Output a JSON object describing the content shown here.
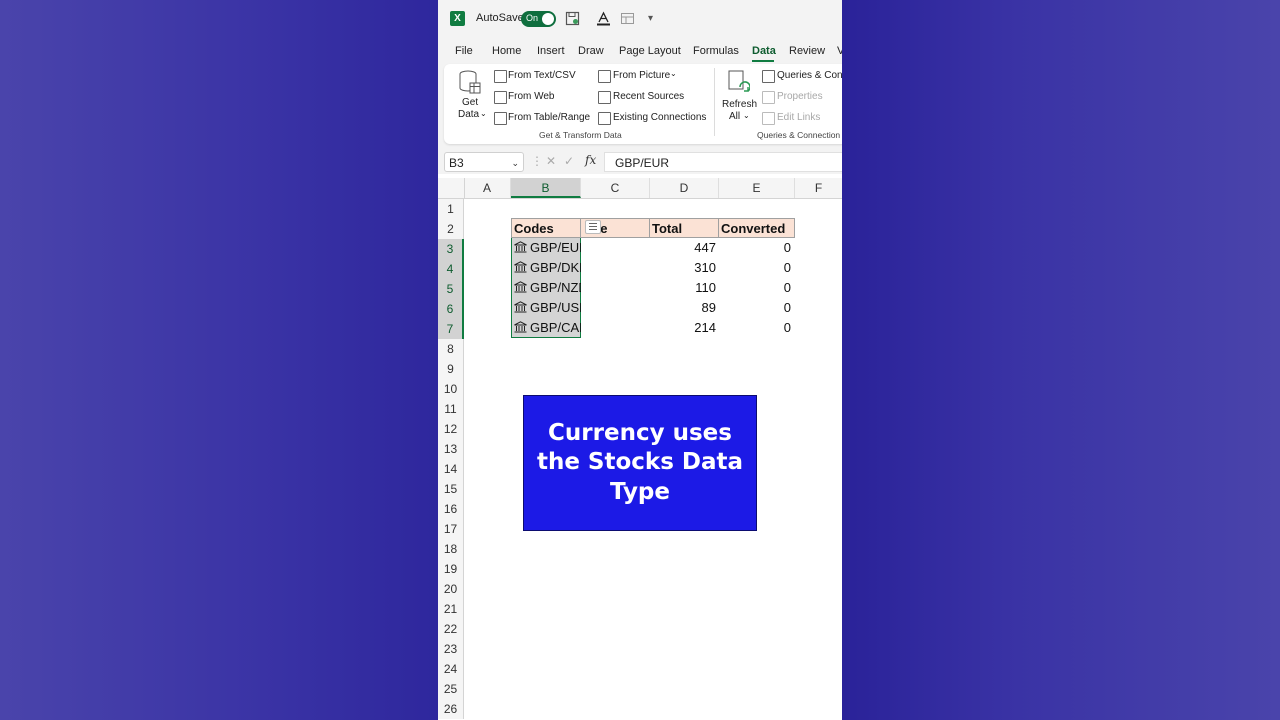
{
  "titlebar": {
    "autosave_label": "AutoSave",
    "autosave_state": "On",
    "logo": "X"
  },
  "tabs": [
    "File",
    "Home",
    "Insert",
    "Draw",
    "Page Layout",
    "Formulas",
    "Data",
    "Review",
    "V"
  ],
  "active_tab": "Data",
  "ribbon": {
    "get_data": [
      "Get",
      "Data"
    ],
    "from_text_csv": "From Text/CSV",
    "from_web": "From Web",
    "from_table_range": "From Table/Range",
    "from_picture": "From Picture",
    "recent_sources": "Recent Sources",
    "existing_connections": "Existing Connections",
    "group1_label": "Get & Transform Data",
    "refresh_all": [
      "Refresh",
      "All"
    ],
    "queries_connections": "Queries & Conn",
    "properties": "Properties",
    "edit_links": "Edit Links",
    "group2_label": "Queries & Connection"
  },
  "formula_bar": {
    "name_box": "B3",
    "fx": "fx",
    "formula": "GBP/EUR"
  },
  "columns": [
    "A",
    "B",
    "C",
    "D",
    "E",
    "F"
  ],
  "selected_column": "B",
  "rows": [
    "1",
    "2",
    "3",
    "4",
    "5",
    "6",
    "7",
    "8",
    "9",
    "10",
    "11",
    "12",
    "13",
    "14",
    "15",
    "16",
    "17",
    "18",
    "19",
    "20",
    "21",
    "22",
    "23",
    "24",
    "25",
    "26"
  ],
  "table": {
    "headers": [
      "Codes",
      "ce",
      "Total",
      "Converted"
    ],
    "rows": [
      {
        "code": "GBP/EUR",
        "total": "447",
        "converted": "0"
      },
      {
        "code": "GBP/DKK",
        "total": "310",
        "converted": "0"
      },
      {
        "code": "GBP/NZD",
        "total": "110",
        "converted": "0"
      },
      {
        "code": "GBP/USD",
        "total": "89",
        "converted": "0"
      },
      {
        "code": "GBP/CAD",
        "total": "214",
        "converted": "0"
      }
    ]
  },
  "callout": {
    "text": "Currency uses the Stocks Data Type"
  },
  "colors": {
    "accent": "#107c41",
    "header_fill": "#fbe2d5",
    "callout_fill": "#1c1ae6"
  }
}
